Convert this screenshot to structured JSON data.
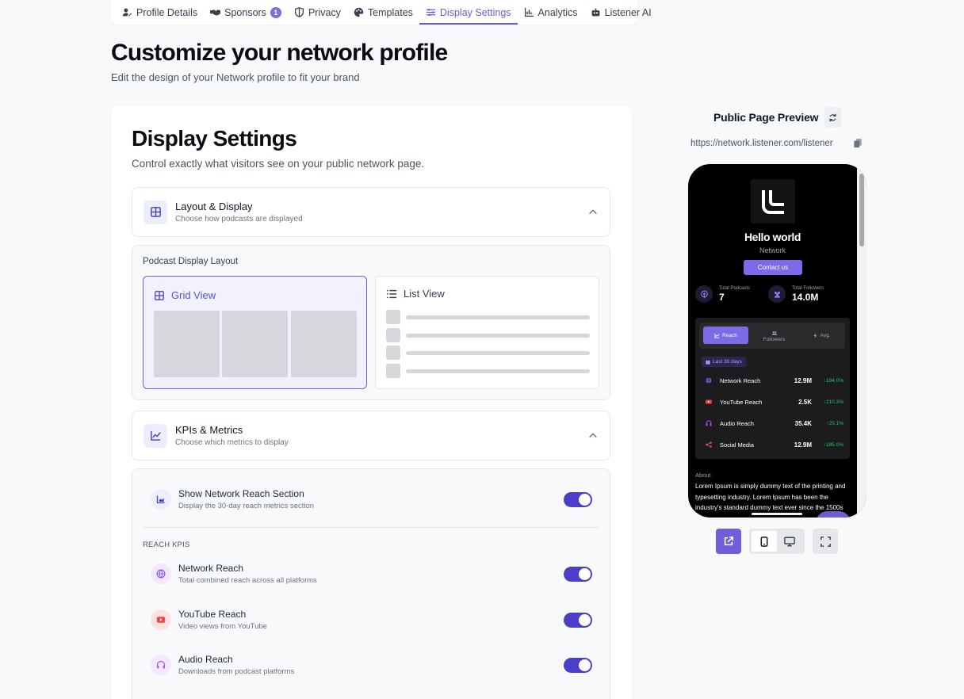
{
  "tabs": [
    {
      "label": "Profile Details",
      "icon": "user-edit-icon"
    },
    {
      "label": "Sponsors",
      "icon": "handshake-icon",
      "badge": "1"
    },
    {
      "label": "Privacy",
      "icon": "shield-icon"
    },
    {
      "label": "Templates",
      "icon": "palette-icon"
    },
    {
      "label": "Display Settings",
      "icon": "sliders-icon",
      "active": true
    },
    {
      "label": "Analytics",
      "icon": "chart-icon"
    },
    {
      "label": "Listener AI",
      "icon": "robot-icon"
    }
  ],
  "header": {
    "title": "Customize your network profile",
    "subtitle": "Edit the design of your Network profile to fit your brand"
  },
  "display_settings": {
    "title": "Display Settings",
    "subtitle": "Control exactly what visitors see on your public network page.",
    "layout_section": {
      "title": "Layout & Display",
      "subtitle": "Choose how podcasts are displayed",
      "panel_label": "Podcast Display Layout",
      "grid_label": "Grid View",
      "list_label": "List View"
    },
    "kpi_section": {
      "title": "KPIs & Metrics",
      "subtitle": "Choose which metrics to display",
      "show_reach": {
        "title": "Show Network Reach Section",
        "subtitle": "Display the 30-day reach metrics section",
        "enabled": true
      },
      "reach_label": "REACH KPIS",
      "kpis": [
        {
          "title": "Network Reach",
          "subtitle": "Total combined reach across all platforms",
          "enabled": true
        },
        {
          "title": "YouTube Reach",
          "subtitle": "Video views from YouTube",
          "enabled": true
        },
        {
          "title": "Audio Reach",
          "subtitle": "Downloads from podcast platforms",
          "enabled": true
        }
      ]
    }
  },
  "preview": {
    "title": "Public Page Preview",
    "url": "https://network.listener.com/listener",
    "profile": {
      "name": "Hello world",
      "type": "Network",
      "contact_label": "Contact us",
      "stats": [
        {
          "label": "Total Podcasts",
          "value": "7"
        },
        {
          "label": "Total Followers",
          "value": "14.0M"
        }
      ],
      "segments": [
        "Reach",
        "Followers",
        "Avg."
      ],
      "date_range": "Last 30 days",
      "metrics": [
        {
          "label": "Network Reach",
          "value": "12.9M",
          "change": "184.0%",
          "color": "#8b5cf6"
        },
        {
          "label": "YouTube Reach",
          "value": "2.5K",
          "change": "210.3%",
          "color": "#ef4444"
        },
        {
          "label": "Audio Reach",
          "value": "35.4K",
          "change": "25.1%",
          "color": "#a855f7"
        },
        {
          "label": "Social Media",
          "value": "12.9M",
          "change": "185.0%",
          "color": "#ec4899"
        }
      ],
      "about_label": "About",
      "about_text": "Lorem Ipsum is simply dummy text of the printing and typesetting industry. Lorem Ipsum has been the industry's standard dummy text ever since the 1500s"
    }
  },
  "colors": {
    "accent": "#6d5dd3",
    "toggle": "#4b3fc9",
    "positive": "#22c55e"
  }
}
